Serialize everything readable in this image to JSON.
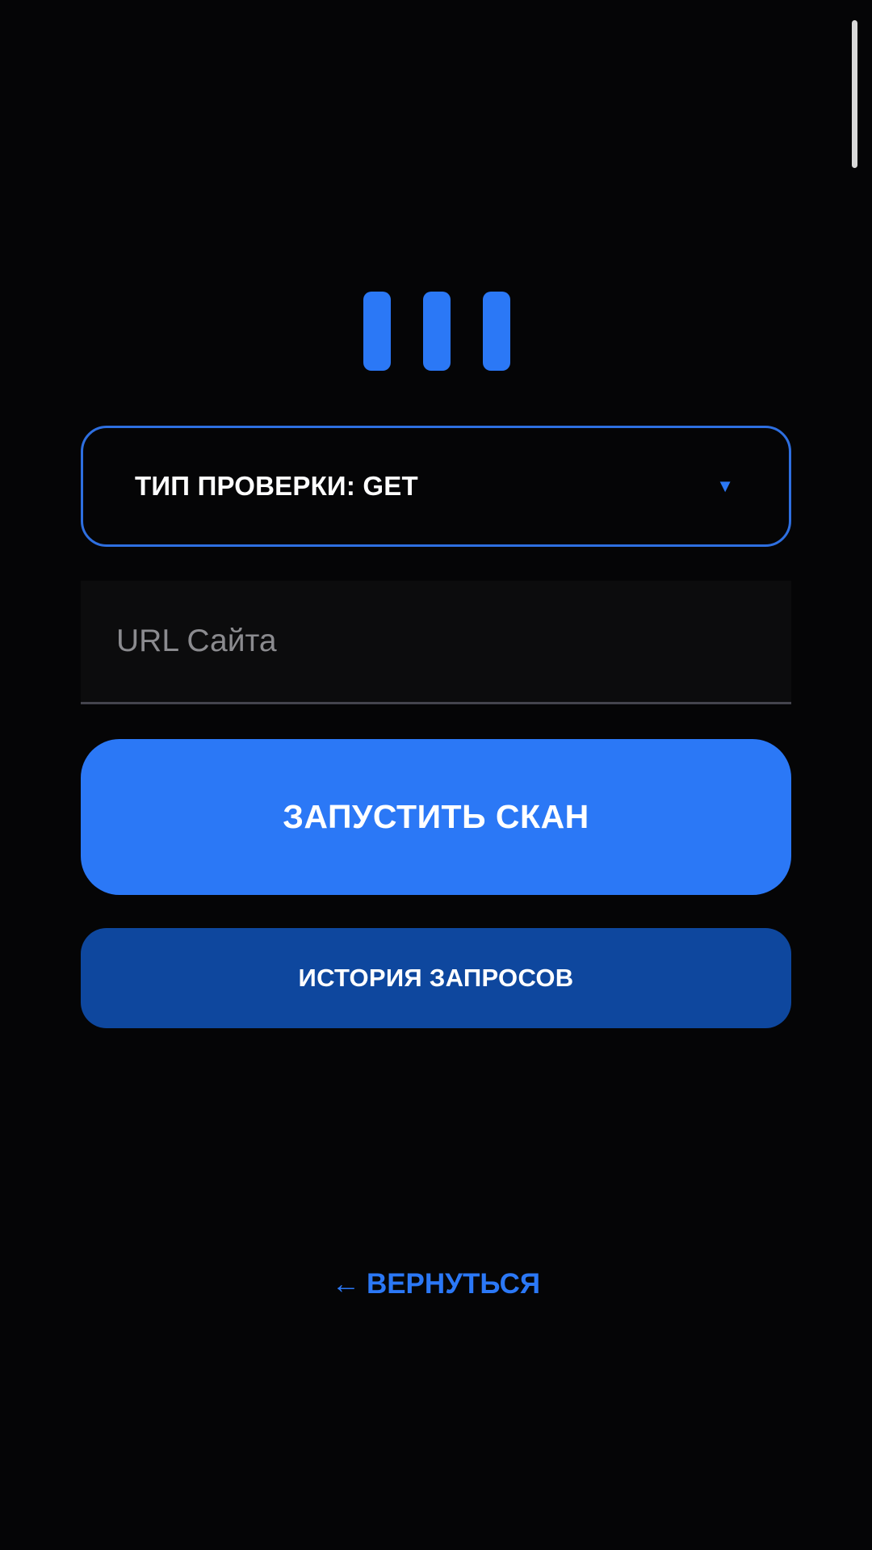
{
  "colors": {
    "background": "#050506",
    "accent": "#2b78f6",
    "secondary_button": "#0e479e",
    "select_border": "#2e6fe0",
    "field_background": "#0c0c0d"
  },
  "logo": {
    "icon": "three-vertical-bars-logo"
  },
  "check_type_select": {
    "label": "ТИП ПРОВЕРКИ: GET",
    "arrow_glyph": "▼",
    "arrow_icon": "dropdown-triangle-icon"
  },
  "url_input": {
    "value": "",
    "placeholder": "URL Сайта"
  },
  "buttons": {
    "scan_label": "ЗАПУСТИТЬ СКАН",
    "history_label": "ИСТОРИЯ ЗАПРОСОВ"
  },
  "back_link": {
    "arrow_glyph": "←",
    "arrow_icon": "left-arrow-icon",
    "label": "ВЕРНУТЬСЯ"
  }
}
